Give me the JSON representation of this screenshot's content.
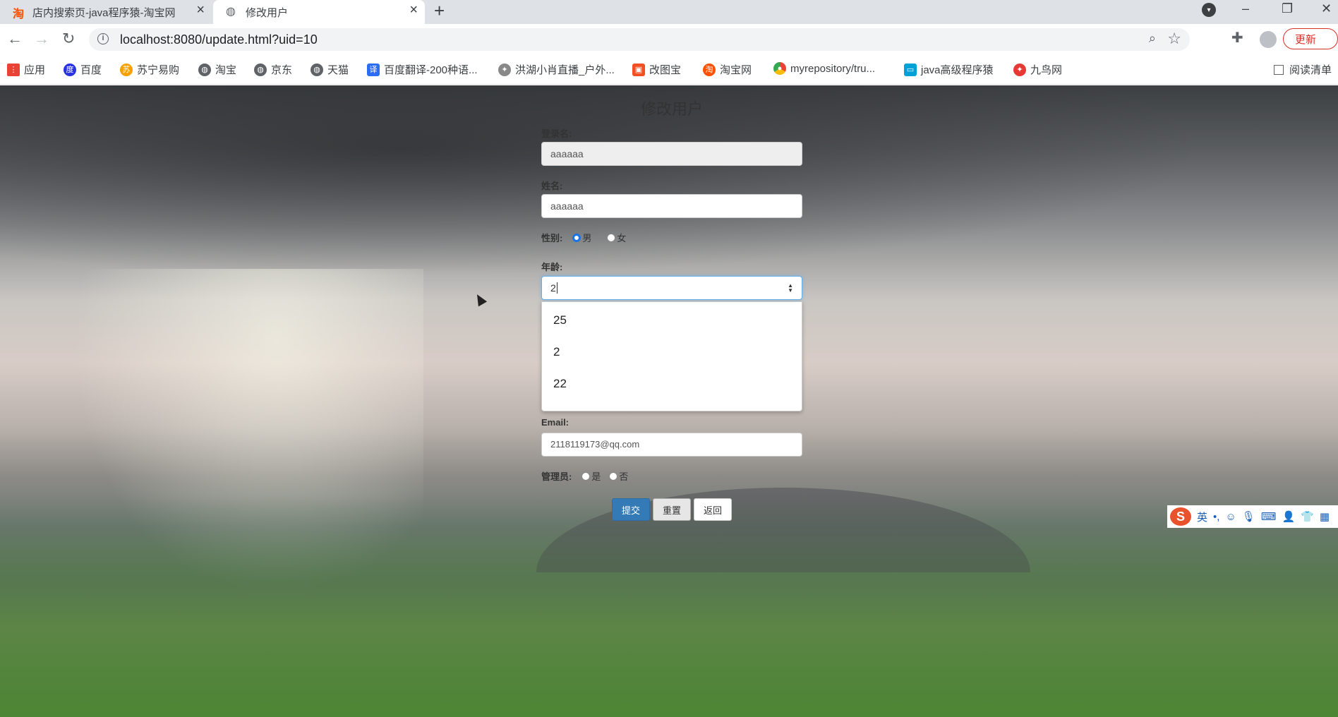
{
  "browser": {
    "tabs": [
      {
        "title": "店内搜索页-java程序猿-淘宝网",
        "favicon": "taobao-icon",
        "active": false
      },
      {
        "title": "修改用户",
        "favicon": "globe-icon",
        "active": true
      }
    ],
    "url": "localhost:8080/update.html?uid=10",
    "update_label": "更新",
    "bookmarks": [
      {
        "label": "应用",
        "icon": "apps-icon"
      },
      {
        "label": "百度",
        "icon": "baidu-icon"
      },
      {
        "label": "苏宁易购",
        "icon": "suning-icon"
      },
      {
        "label": "淘宝",
        "icon": "globe-icon"
      },
      {
        "label": "京东",
        "icon": "globe-icon"
      },
      {
        "label": "天猫",
        "icon": "globe-icon"
      },
      {
        "label": "百度翻译-200种语...",
        "icon": "translate-icon"
      },
      {
        "label": "洪湖小肖直播_户外...",
        "icon": "bird-icon"
      },
      {
        "label": "改图宝",
        "icon": "image-icon"
      },
      {
        "label": "淘宝网",
        "icon": "taobao-icon"
      },
      {
        "label": "myrepository/tru...",
        "icon": "chrome-icon"
      },
      {
        "label": "java高级程序猿",
        "icon": "bilibili-icon"
      },
      {
        "label": "九鸟网",
        "icon": "bird-icon"
      }
    ],
    "reading_list": "阅读清单"
  },
  "form": {
    "title": "修改用户",
    "login_label": "登录名:",
    "login_value": "aaaaaa",
    "name_label": "姓名:",
    "name_value": "aaaaaa",
    "gender_label": "性别:",
    "gender_options": [
      "男",
      "女"
    ],
    "gender_selected": "男",
    "age_label": "年龄:",
    "age_value": "2",
    "age_suggestions": [
      "25",
      "2",
      "22"
    ],
    "email_label": "Email:",
    "email_value": "2118119173@qq.com",
    "admin_label": "管理员:",
    "admin_options": [
      "是",
      "否"
    ],
    "submit_label": "提交",
    "reset_label": "重置",
    "back_label": "返回"
  },
  "ime": {
    "mode": "英"
  },
  "colors": {
    "primary": "#337ab7",
    "focus": "#66afe9",
    "update": "#d93025"
  }
}
